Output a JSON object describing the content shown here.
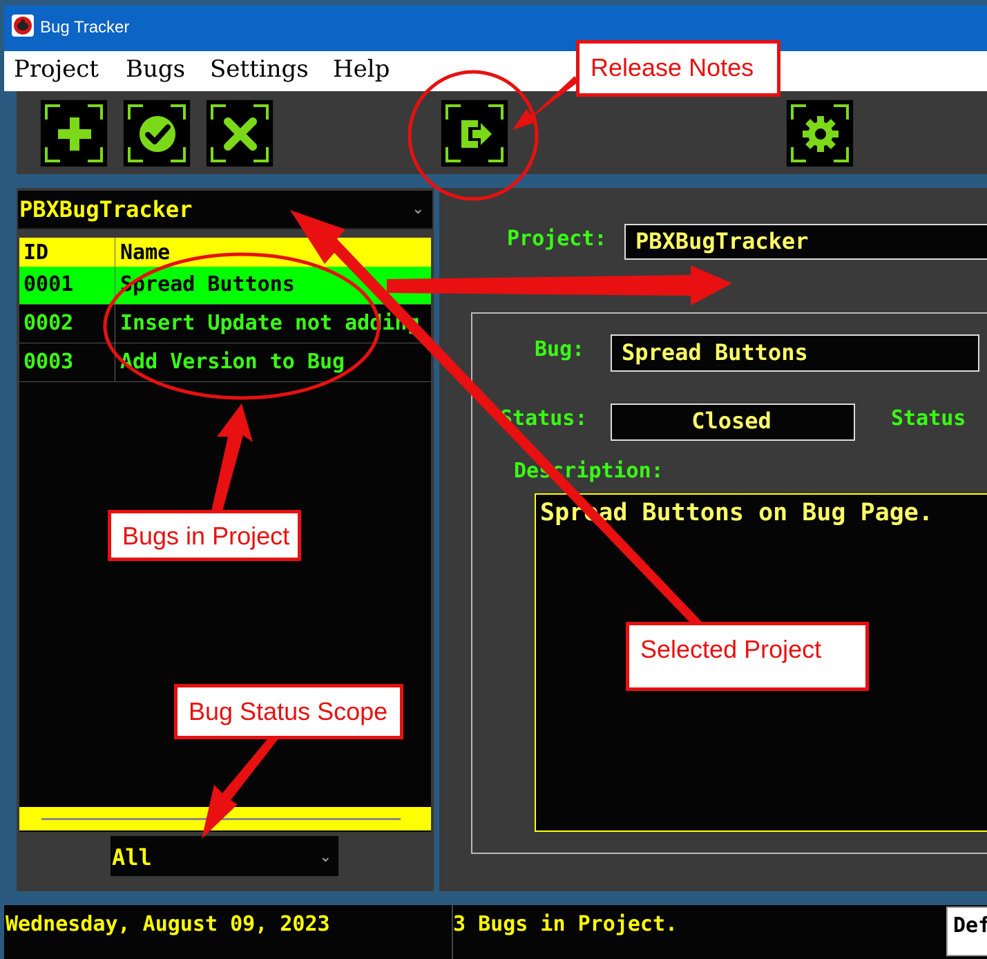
{
  "window": {
    "title": "Bug Tracker"
  },
  "menu": {
    "items": [
      "Project",
      "Bugs",
      "Settings",
      "Help"
    ]
  },
  "toolbar": {
    "buttons": [
      "plus-icon",
      "check-icon",
      "x-icon",
      "release-notes-icon",
      "gear-icon"
    ],
    "accent": "#7cd919"
  },
  "project_selector": {
    "value": "PBXBugTracker"
  },
  "bug_grid": {
    "columns": [
      "ID",
      "Name"
    ],
    "rows": [
      {
        "id": "0001",
        "name": "Spread Buttons",
        "selected": true
      },
      {
        "id": "0002",
        "name": "Insert Update not adding",
        "selected": false
      },
      {
        "id": "0003",
        "name": "Add Version to Bug",
        "selected": false
      }
    ]
  },
  "status_scope": {
    "value": "All"
  },
  "details": {
    "project_label": "Project:",
    "project_value": "PBXBugTracker",
    "bug_label": "Bug:",
    "bug_value": "Spread Buttons",
    "status_label": "Status:",
    "status_value": "Closed",
    "status_label_2": "Status",
    "description_label": "Description:",
    "description_value": "Spread Buttons on Bug Page."
  },
  "statusbar": {
    "date": "Wednesday, August 09, 2023",
    "count": "3 Bugs in Project.",
    "button_label": "Def"
  },
  "callouts": {
    "release_notes": "Release Notes",
    "bugs_in_project": "Bugs in Project",
    "selected_project": "Selected Project",
    "bug_status_scope": "Bug Status Scope"
  },
  "colors": {
    "callout_red": "#e81010",
    "grid_header": "#ffff00",
    "selected_row": "#00ff00",
    "text_green": "#39ff14",
    "text_yellow": "#ffff66"
  }
}
